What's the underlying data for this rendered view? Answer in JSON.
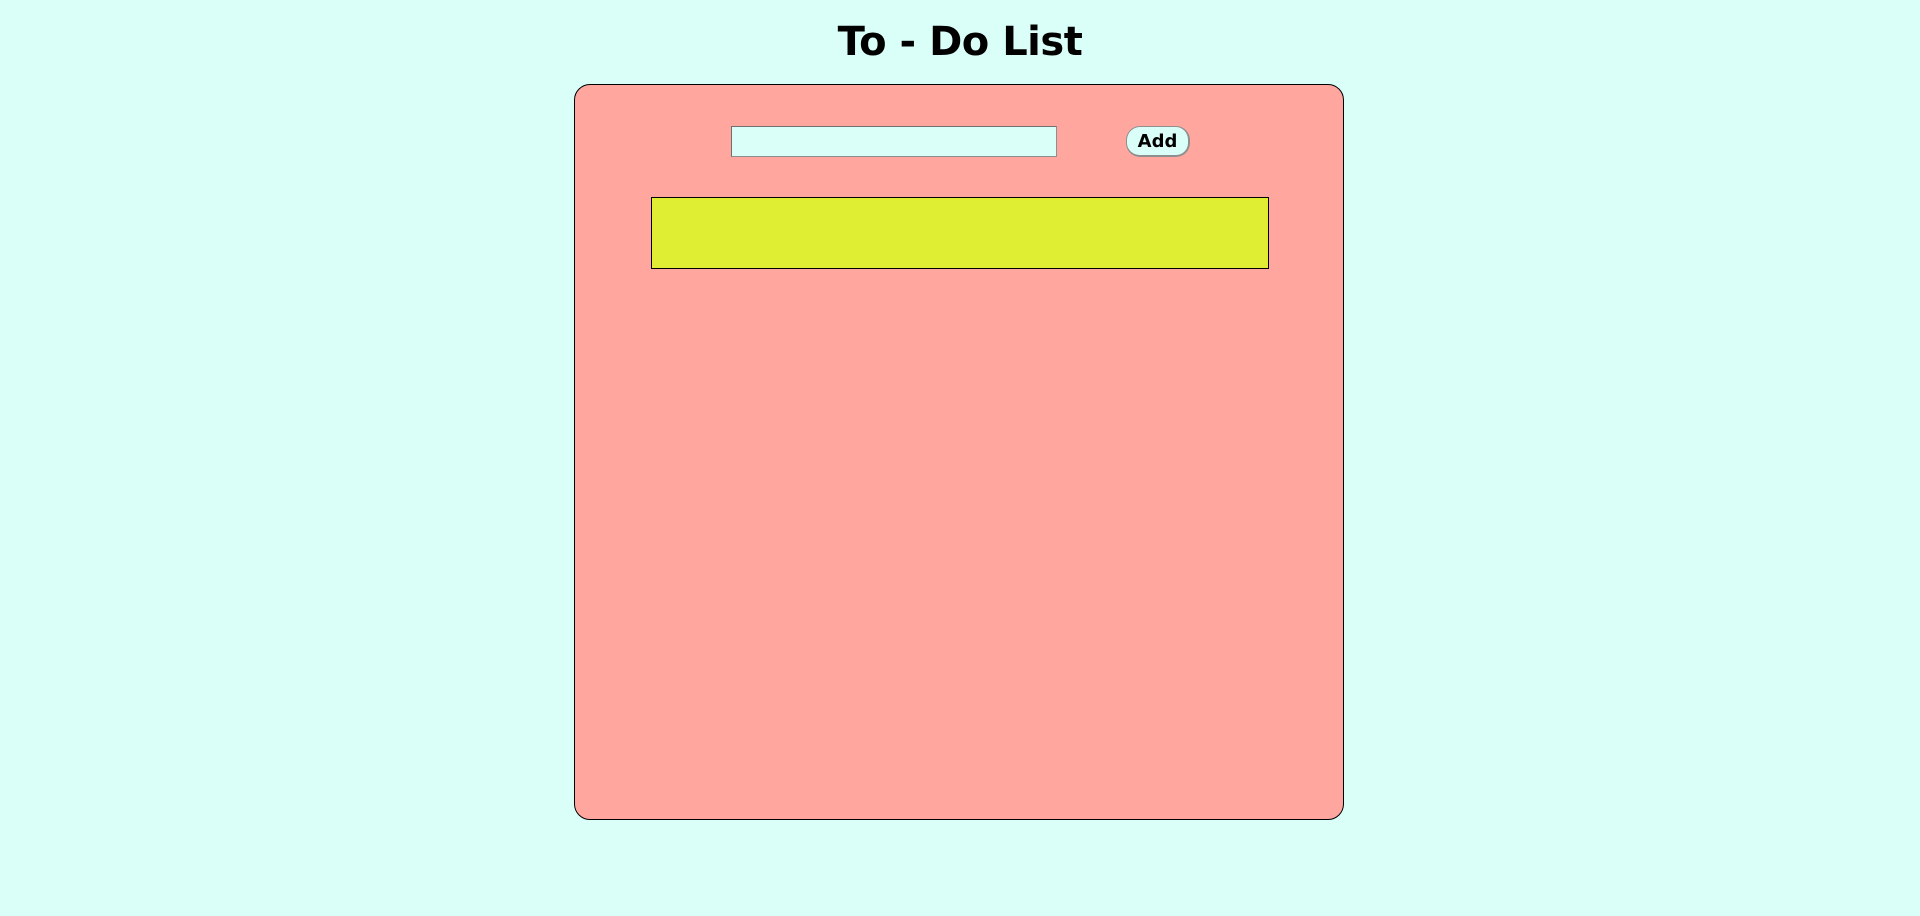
{
  "page": {
    "title": "To - Do List"
  },
  "todo": {
    "input_value": "",
    "input_placeholder": "",
    "add_label": "Add",
    "items": []
  },
  "colors": {
    "background": "#dafff9",
    "card": "#ffa69e",
    "list": "#dfee32",
    "border": "#000000"
  }
}
